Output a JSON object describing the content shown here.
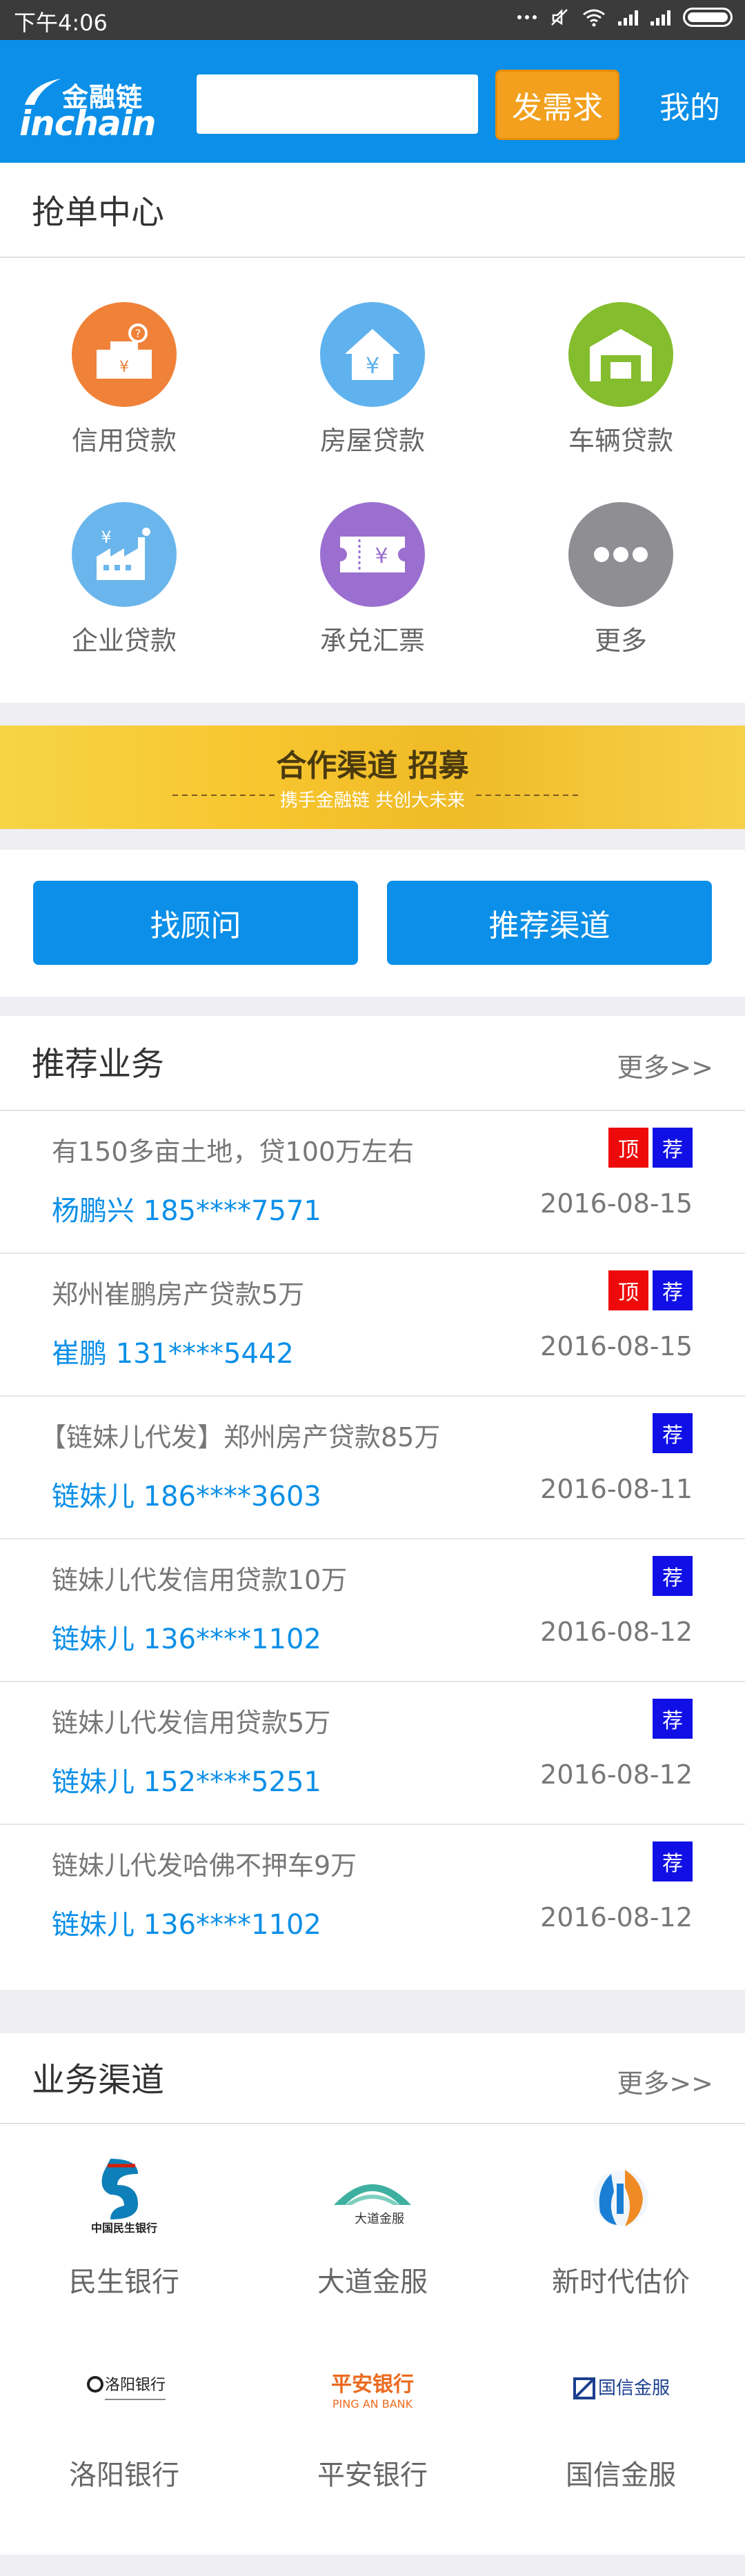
{
  "status_bar": {
    "time": "下午4:06"
  },
  "header": {
    "logo_cn": "金融链",
    "logo_en": "inchain",
    "search_placeholder": "",
    "post_button": "发需求",
    "mine_link": "我的"
  },
  "grab_center": {
    "title": "抢单中心",
    "categories": [
      {
        "label": "信用贷款",
        "icon": "credit-loan-icon",
        "color": "#f08138"
      },
      {
        "label": "房屋贷款",
        "icon": "house-loan-icon",
        "color": "#5fb2ee"
      },
      {
        "label": "车辆贷款",
        "icon": "car-loan-icon",
        "color": "#84bd2d"
      },
      {
        "label": "企业贷款",
        "icon": "enterprise-loan-icon",
        "color": "#6ab6ec"
      },
      {
        "label": "承兑汇票",
        "icon": "bill-icon",
        "color": "#9b6fd0"
      },
      {
        "label": "更多",
        "icon": "more-icon",
        "color": "#8e8e93"
      }
    ]
  },
  "banner": {
    "title": "合作渠道 招募",
    "subtitle": "携手金融链 共创大未来"
  },
  "actions": {
    "find_advisor": "找顾问",
    "recommend_channel": "推荐渠道"
  },
  "recommended": {
    "title": "推荐业务",
    "more": "更多>>",
    "items": [
      {
        "title": "有150多亩土地，贷100万左右",
        "contact": "杨鹏兴 185****7571",
        "date": "2016-08-15",
        "badges": [
          "顶",
          "荐"
        ]
      },
      {
        "title": "郑州崔鹏房产贷款5万",
        "contact": "崔鹏 131****5442",
        "date": "2016-08-15",
        "badges": [
          "顶",
          "荐"
        ]
      },
      {
        "title": "【链妹儿代发】郑州房产贷款85万",
        "contact": "链妹儿 186****3603",
        "date": "2016-08-11",
        "badges": [
          "荐"
        ]
      },
      {
        "title": "链妹儿代发信用贷款10万",
        "contact": "链妹儿 136****1102",
        "date": "2016-08-12",
        "badges": [
          "荐"
        ]
      },
      {
        "title": "链妹儿代发信用贷款5万",
        "contact": "链妹儿 152****5251",
        "date": "2016-08-12",
        "badges": [
          "荐"
        ]
      },
      {
        "title": "链妹儿代发哈佛不押车9万",
        "contact": "链妹儿 136****1102",
        "date": "2016-08-12",
        "badges": [
          "荐"
        ]
      }
    ]
  },
  "channels": {
    "title": "业务渠道",
    "more": "更多>>",
    "items": [
      {
        "name": "民生银行",
        "logo_text": "中国民生银行"
      },
      {
        "name": "大道金服",
        "logo_text": "大道金服"
      },
      {
        "name": "新时代估价",
        "logo_text": ""
      },
      {
        "name": "洛阳银行",
        "logo_text": "洛阳银行"
      },
      {
        "name": "平安银行",
        "logo_text": "平安银行"
      },
      {
        "name": "国信金服",
        "logo_text": "国信金服"
      }
    ]
  }
}
